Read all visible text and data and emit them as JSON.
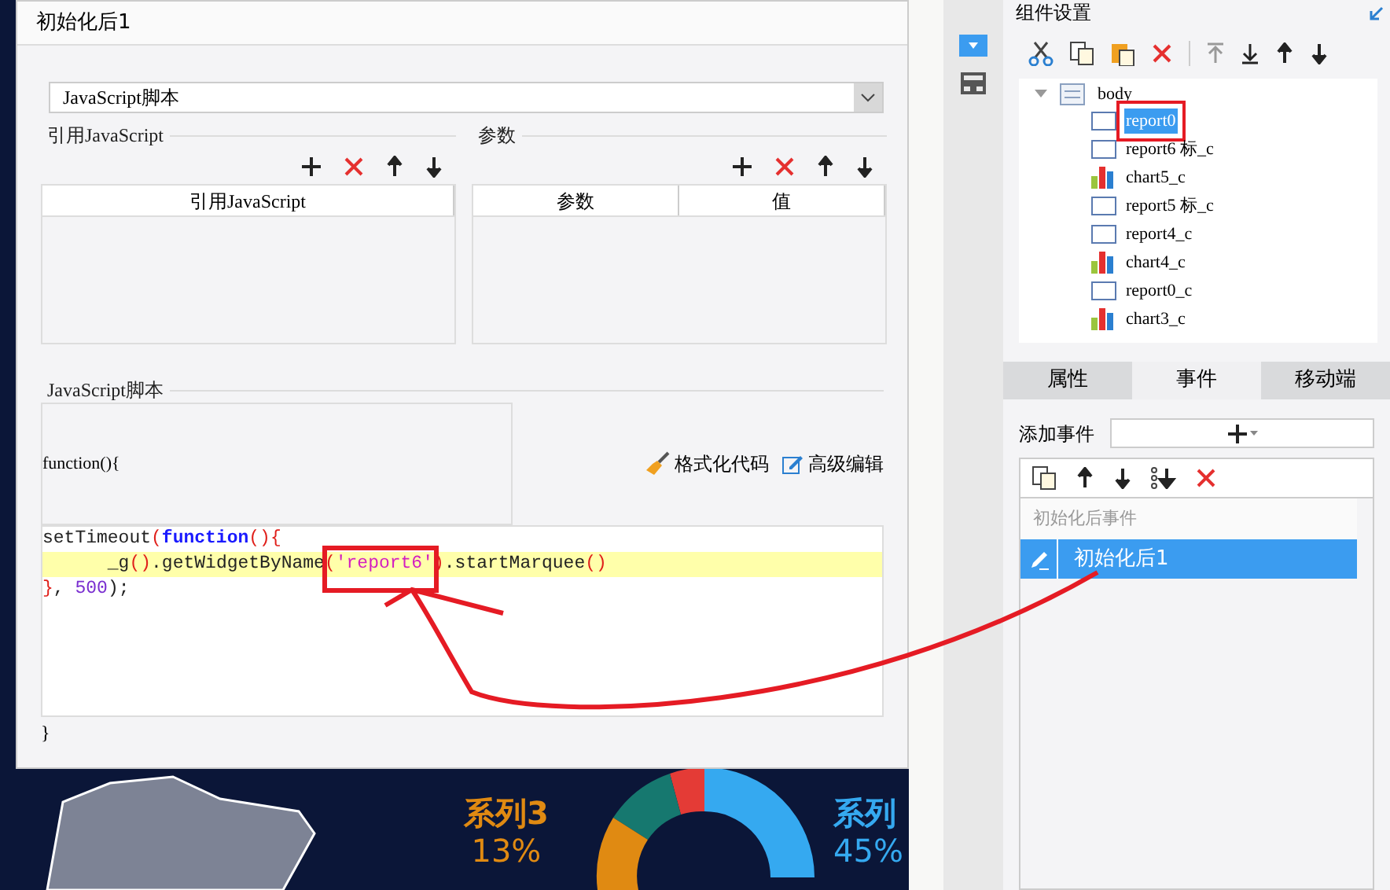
{
  "dialog": {
    "title": "初始化后1",
    "type_select": {
      "value": "JavaScript脚本"
    },
    "ref_section": {
      "title": "引用JavaScript",
      "columns": [
        "引用JavaScript"
      ]
    },
    "param_section": {
      "title": "参数",
      "columns": [
        "参数",
        "值"
      ]
    },
    "script_section": {
      "title": "JavaScript脚本",
      "header": "function(){",
      "footer": "}",
      "actions": [
        {
          "kind": "format",
          "label": "格式化代码"
        },
        {
          "kind": "advanced",
          "label": "高级编辑"
        }
      ],
      "code": [
        {
          "highlighted": false,
          "tokens": [
            {
              "kind": "plain",
              "text": "setTimeout"
            },
            {
              "kind": "paren",
              "text": "("
            },
            {
              "kind": "keyword",
              "text": "function"
            },
            {
              "kind": "paren",
              "text": "(){"
            }
          ]
        },
        {
          "highlighted": true,
          "tokens": [
            {
              "kind": "plain",
              "text": "      _g"
            },
            {
              "kind": "paren",
              "text": "()"
            },
            {
              "kind": "plain",
              "text": ".getWidgetByName"
            },
            {
              "kind": "paren",
              "text": "("
            },
            {
              "kind": "string",
              "text": "'report6'"
            },
            {
              "kind": "paren",
              "text": ")"
            },
            {
              "kind": "plain",
              "text": ".startMarquee"
            },
            {
              "kind": "paren",
              "text": "()"
            }
          ]
        },
        {
          "highlighted": false,
          "tokens": [
            {
              "kind": "paren",
              "text": "}"
            },
            {
              "kind": "plain",
              "text": ", "
            },
            {
              "kind": "number",
              "text": "500"
            },
            {
              "kind": "plain",
              "text": ");"
            }
          ]
        }
      ]
    }
  },
  "dashboard": {
    "labels": [
      {
        "kind": "series3",
        "name": "系列3",
        "value": "13%"
      },
      {
        "kind": "series1",
        "name": "系列",
        "value": "45%"
      }
    ]
  },
  "panel": {
    "title": "组件设置",
    "tree": {
      "label": "body",
      "expanded": true,
      "children": [
        {
          "label": "report0",
          "kind": "report",
          "selected": true
        },
        {
          "label": "report6 标_c",
          "kind": "report",
          "selected": false
        },
        {
          "label": "chart5_c",
          "kind": "chart",
          "selected": false
        },
        {
          "label": "report5 标_c",
          "kind": "report",
          "selected": false
        },
        {
          "label": "report4_c",
          "kind": "report",
          "selected": false
        },
        {
          "label": "chart4_c",
          "kind": "chart",
          "selected": false
        },
        {
          "label": "report0_c",
          "kind": "report",
          "selected": false
        },
        {
          "label": "chart3_c",
          "kind": "chart",
          "selected": false
        }
      ]
    },
    "tabs": [
      {
        "label": "属性",
        "selected": false
      },
      {
        "label": "事件",
        "selected": true
      },
      {
        "label": "移动端",
        "selected": false
      }
    ],
    "add_event_label": "添加事件",
    "events": {
      "group": "初始化后事件",
      "items": [
        {
          "label": "初始化后1",
          "selected": true
        }
      ]
    }
  }
}
